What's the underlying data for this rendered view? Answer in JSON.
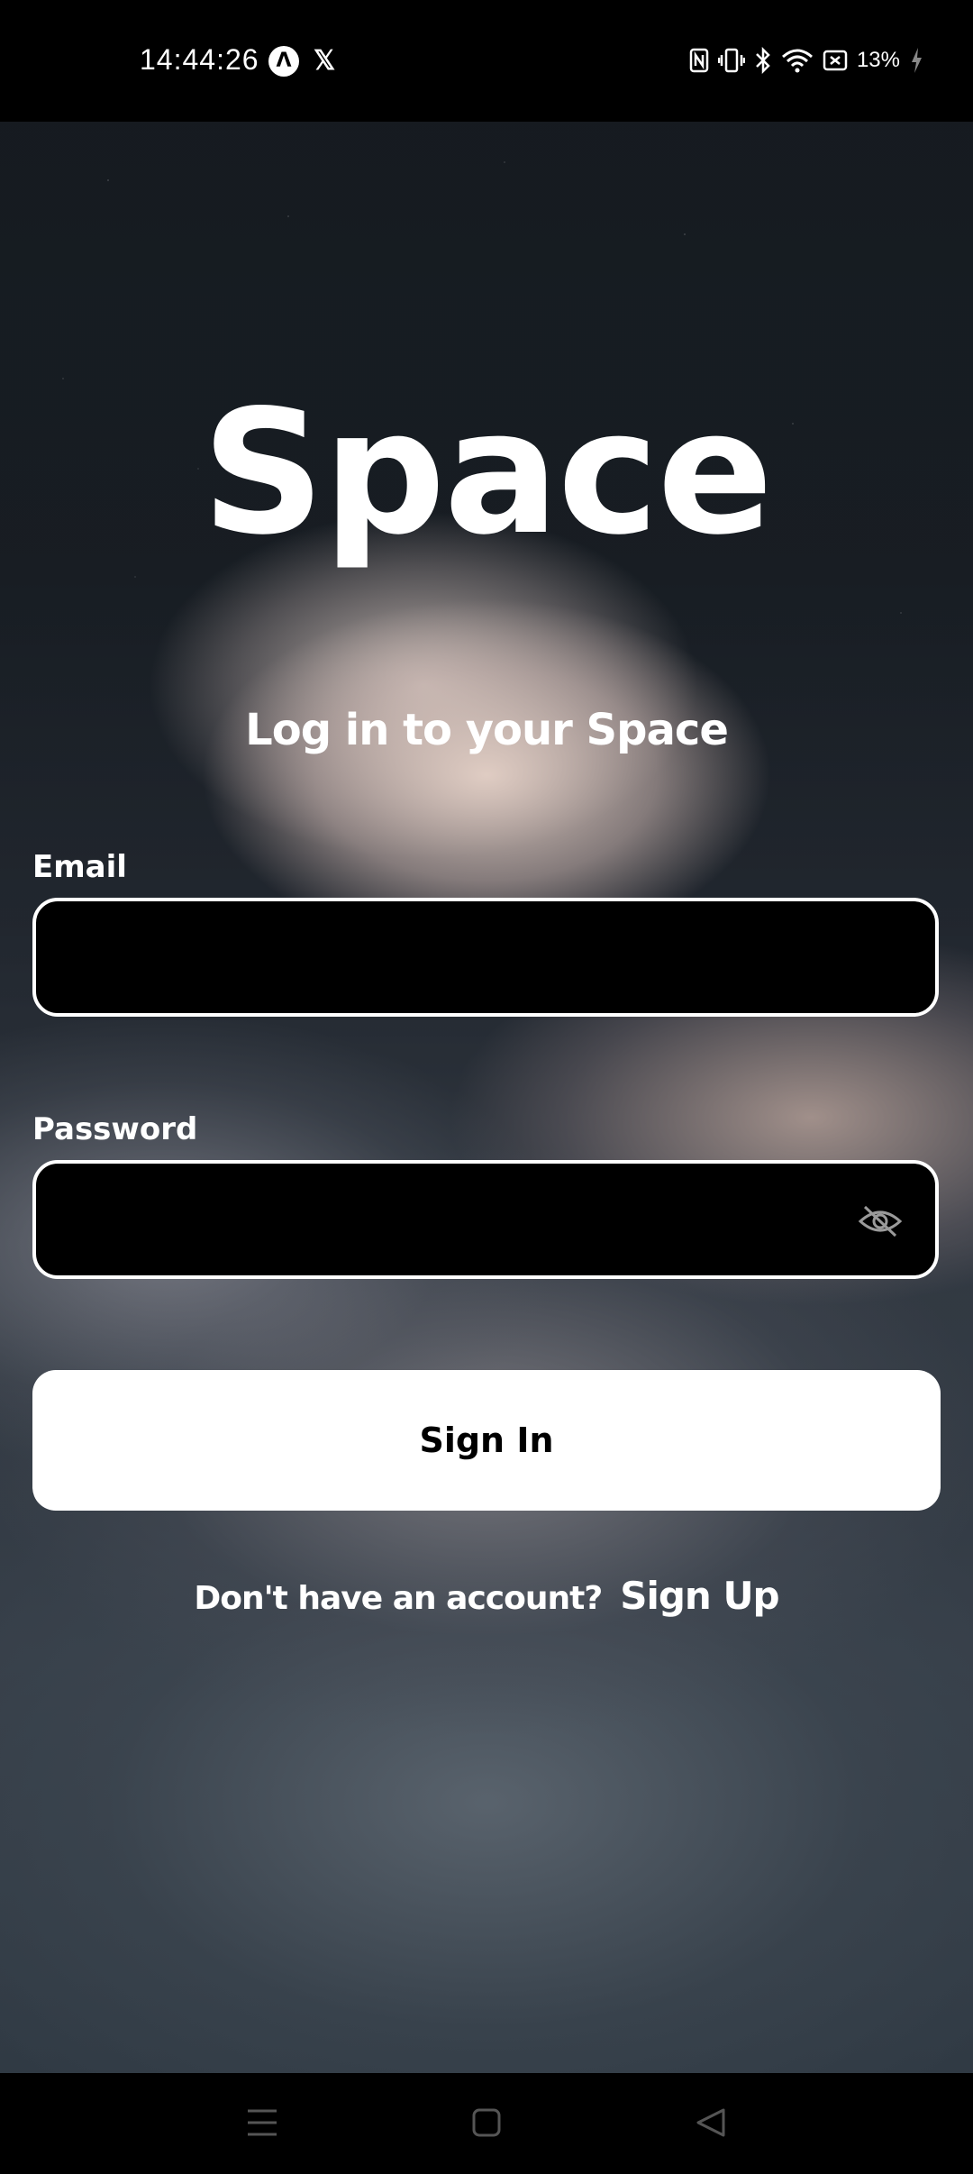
{
  "status_bar": {
    "time": "14:44:26",
    "left_icons": [
      "app-a-icon",
      "x-logo-icon"
    ],
    "right_icons": [
      "nfc-icon",
      "vibrate-icon",
      "bluetooth-icon",
      "wifi-icon",
      "battery-saver-icon"
    ],
    "battery": "13%"
  },
  "app": {
    "title": "Space",
    "subtitle": "Log in to your Space"
  },
  "form": {
    "email_label": "Email",
    "email_value": "",
    "password_label": "Password",
    "password_value": "",
    "password_toggle_icon": "eye-off-icon",
    "submit_label": "Sign In"
  },
  "signup": {
    "prompt": "Don't have an account?",
    "link": "Sign Up"
  },
  "nav": {
    "items": [
      "menu-icon",
      "home-icon",
      "back-icon"
    ]
  },
  "colors": {
    "background": "#000000",
    "text": "#ffffff",
    "button_bg": "#ffffff",
    "button_text": "#000000"
  }
}
